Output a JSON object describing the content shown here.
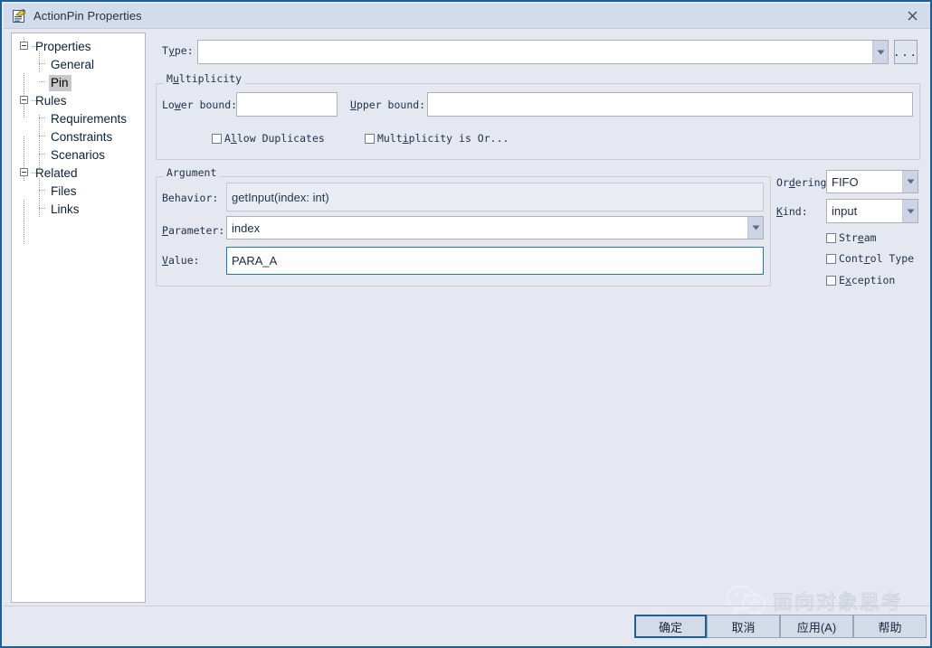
{
  "window": {
    "title": "ActionPin Properties",
    "icon": "properties-document-icon",
    "close_icon": "close-icon",
    "accent_color": "#1d6096",
    "background_color": "#e5e8f1",
    "titlebar_color": "#d3dcea"
  },
  "tree": {
    "name": "navigation-tree",
    "nodes": [
      {
        "label": "Properties",
        "level": 0,
        "expanded": true,
        "selected": false
      },
      {
        "label": "General",
        "level": 1,
        "expanded": false,
        "selected": false
      },
      {
        "label": "Pin",
        "level": 1,
        "expanded": false,
        "selected": true
      },
      {
        "label": "Rules",
        "level": 0,
        "expanded": true,
        "selected": false
      },
      {
        "label": "Requirements",
        "level": 1,
        "expanded": false,
        "selected": false
      },
      {
        "label": "Constraints",
        "level": 1,
        "expanded": false,
        "selected": false
      },
      {
        "label": "Scenarios",
        "level": 1,
        "expanded": false,
        "selected": false
      },
      {
        "label": "Related",
        "level": 0,
        "expanded": true,
        "selected": false
      },
      {
        "label": "Files",
        "level": 1,
        "expanded": false,
        "selected": false
      },
      {
        "label": "Links",
        "level": 1,
        "expanded": false,
        "selected": false
      }
    ]
  },
  "type_row": {
    "label_pre": "T",
    "label_mnemonic": "y",
    "label_post": "pe:",
    "value": "",
    "placeholder": "",
    "browse_label": "...",
    "dropdown_icon": "chevron-down-icon"
  },
  "multiplicity": {
    "title_pre": "M",
    "title_mnemonic": "u",
    "title_post": "ltiplicity",
    "lower_bound": {
      "label_pre": "Lo",
      "label_mnemonic": "w",
      "label_post": "er bound:",
      "value": ""
    },
    "upper_bound": {
      "label_pre": "",
      "label_mnemonic": "U",
      "label_post": "pper bound:",
      "value": ""
    },
    "allow_duplicates": {
      "label_pre": "A",
      "label_mnemonic": "l",
      "label_post": "low Duplicates",
      "checked": false
    },
    "is_ordered": {
      "label_pre": "Mult",
      "label_mnemonic": "i",
      "label_post": "plicity is Or...",
      "checked": false
    }
  },
  "argument": {
    "title": "Argument",
    "behavior": {
      "label_pre": "Behavior:",
      "label_mnemonic": "",
      "label_post": "",
      "value": "getInput(index: int)",
      "readonly": true
    },
    "parameter": {
      "label_pre": "",
      "label_mnemonic": "P",
      "label_post": "arameter:",
      "value": "index",
      "dropdown_icon": "chevron-down-icon"
    },
    "value_field": {
      "label_pre": "",
      "label_mnemonic": "V",
      "label_post": "alue:",
      "value": "PARA_A",
      "focused": true
    }
  },
  "side_options": {
    "ordering": {
      "label_pre": "Or",
      "label_mnemonic": "d",
      "label_post": "ering:",
      "value": "FIFO",
      "dropdown_icon": "chevron-down-icon"
    },
    "kind": {
      "label_pre": "",
      "label_mnemonic": "K",
      "label_post": "ind:",
      "value": "input",
      "dropdown_icon": "chevron-down-icon"
    },
    "checkboxes": [
      {
        "label_pre": "Str",
        "label_mnemonic": "e",
        "label_post": "am",
        "checked": false,
        "name": "stream"
      },
      {
        "label_pre": "Cont",
        "label_mnemonic": "r",
        "label_post": "ol Type",
        "checked": false,
        "name": "control-type"
      },
      {
        "label_pre": "E",
        "label_mnemonic": "x",
        "label_post": "ception",
        "checked": false,
        "name": "exception"
      }
    ]
  },
  "footer": {
    "ok": "确定",
    "cancel": "取消",
    "apply": "应用(A)",
    "help": "帮助"
  },
  "watermark": {
    "text": "面向对象思考",
    "icon": "wechat-logo-icon"
  }
}
